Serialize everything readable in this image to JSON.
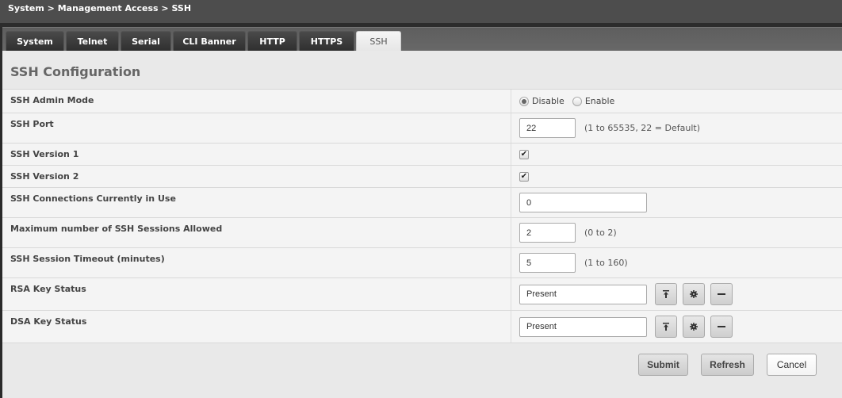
{
  "breadcrumb": "System > Management Access > SSH",
  "tabs": [
    {
      "label": "System",
      "active": false
    },
    {
      "label": "Telnet",
      "active": false
    },
    {
      "label": "Serial",
      "active": false
    },
    {
      "label": "CLI Banner",
      "active": false
    },
    {
      "label": "HTTP",
      "active": false
    },
    {
      "label": "HTTPS",
      "active": false
    },
    {
      "label": "SSH",
      "active": true
    }
  ],
  "section_title": "SSH Configuration",
  "rows": {
    "admin_mode": {
      "label": "SSH Admin Mode",
      "options": [
        {
          "label": "Disable",
          "checked": true
        },
        {
          "label": "Enable",
          "checked": false
        }
      ]
    },
    "port": {
      "label": "SSH Port",
      "value": "22",
      "hint": "(1 to 65535, 22 = Default)"
    },
    "version1": {
      "label": "SSH Version 1",
      "checked": true
    },
    "version2": {
      "label": "SSH Version 2",
      "checked": true
    },
    "connections": {
      "label": "SSH Connections Currently in Use",
      "value": "0"
    },
    "max_sessions": {
      "label": "Maximum number of SSH Sessions Allowed",
      "value": "2",
      "hint": "(0 to 2)"
    },
    "timeout": {
      "label": "SSH Session Timeout (minutes)",
      "value": "5",
      "hint": "(1 to 160)"
    },
    "rsa": {
      "label": "RSA Key Status",
      "value": "Present"
    },
    "dsa": {
      "label": "DSA Key Status",
      "value": "Present"
    }
  },
  "key_actions": {
    "upload_icon": "upload-icon",
    "generate_icon": "gear-icon",
    "delete_icon": "minus-icon"
  },
  "footer": {
    "submit": "Submit",
    "refresh": "Refresh",
    "cancel": "Cancel"
  }
}
